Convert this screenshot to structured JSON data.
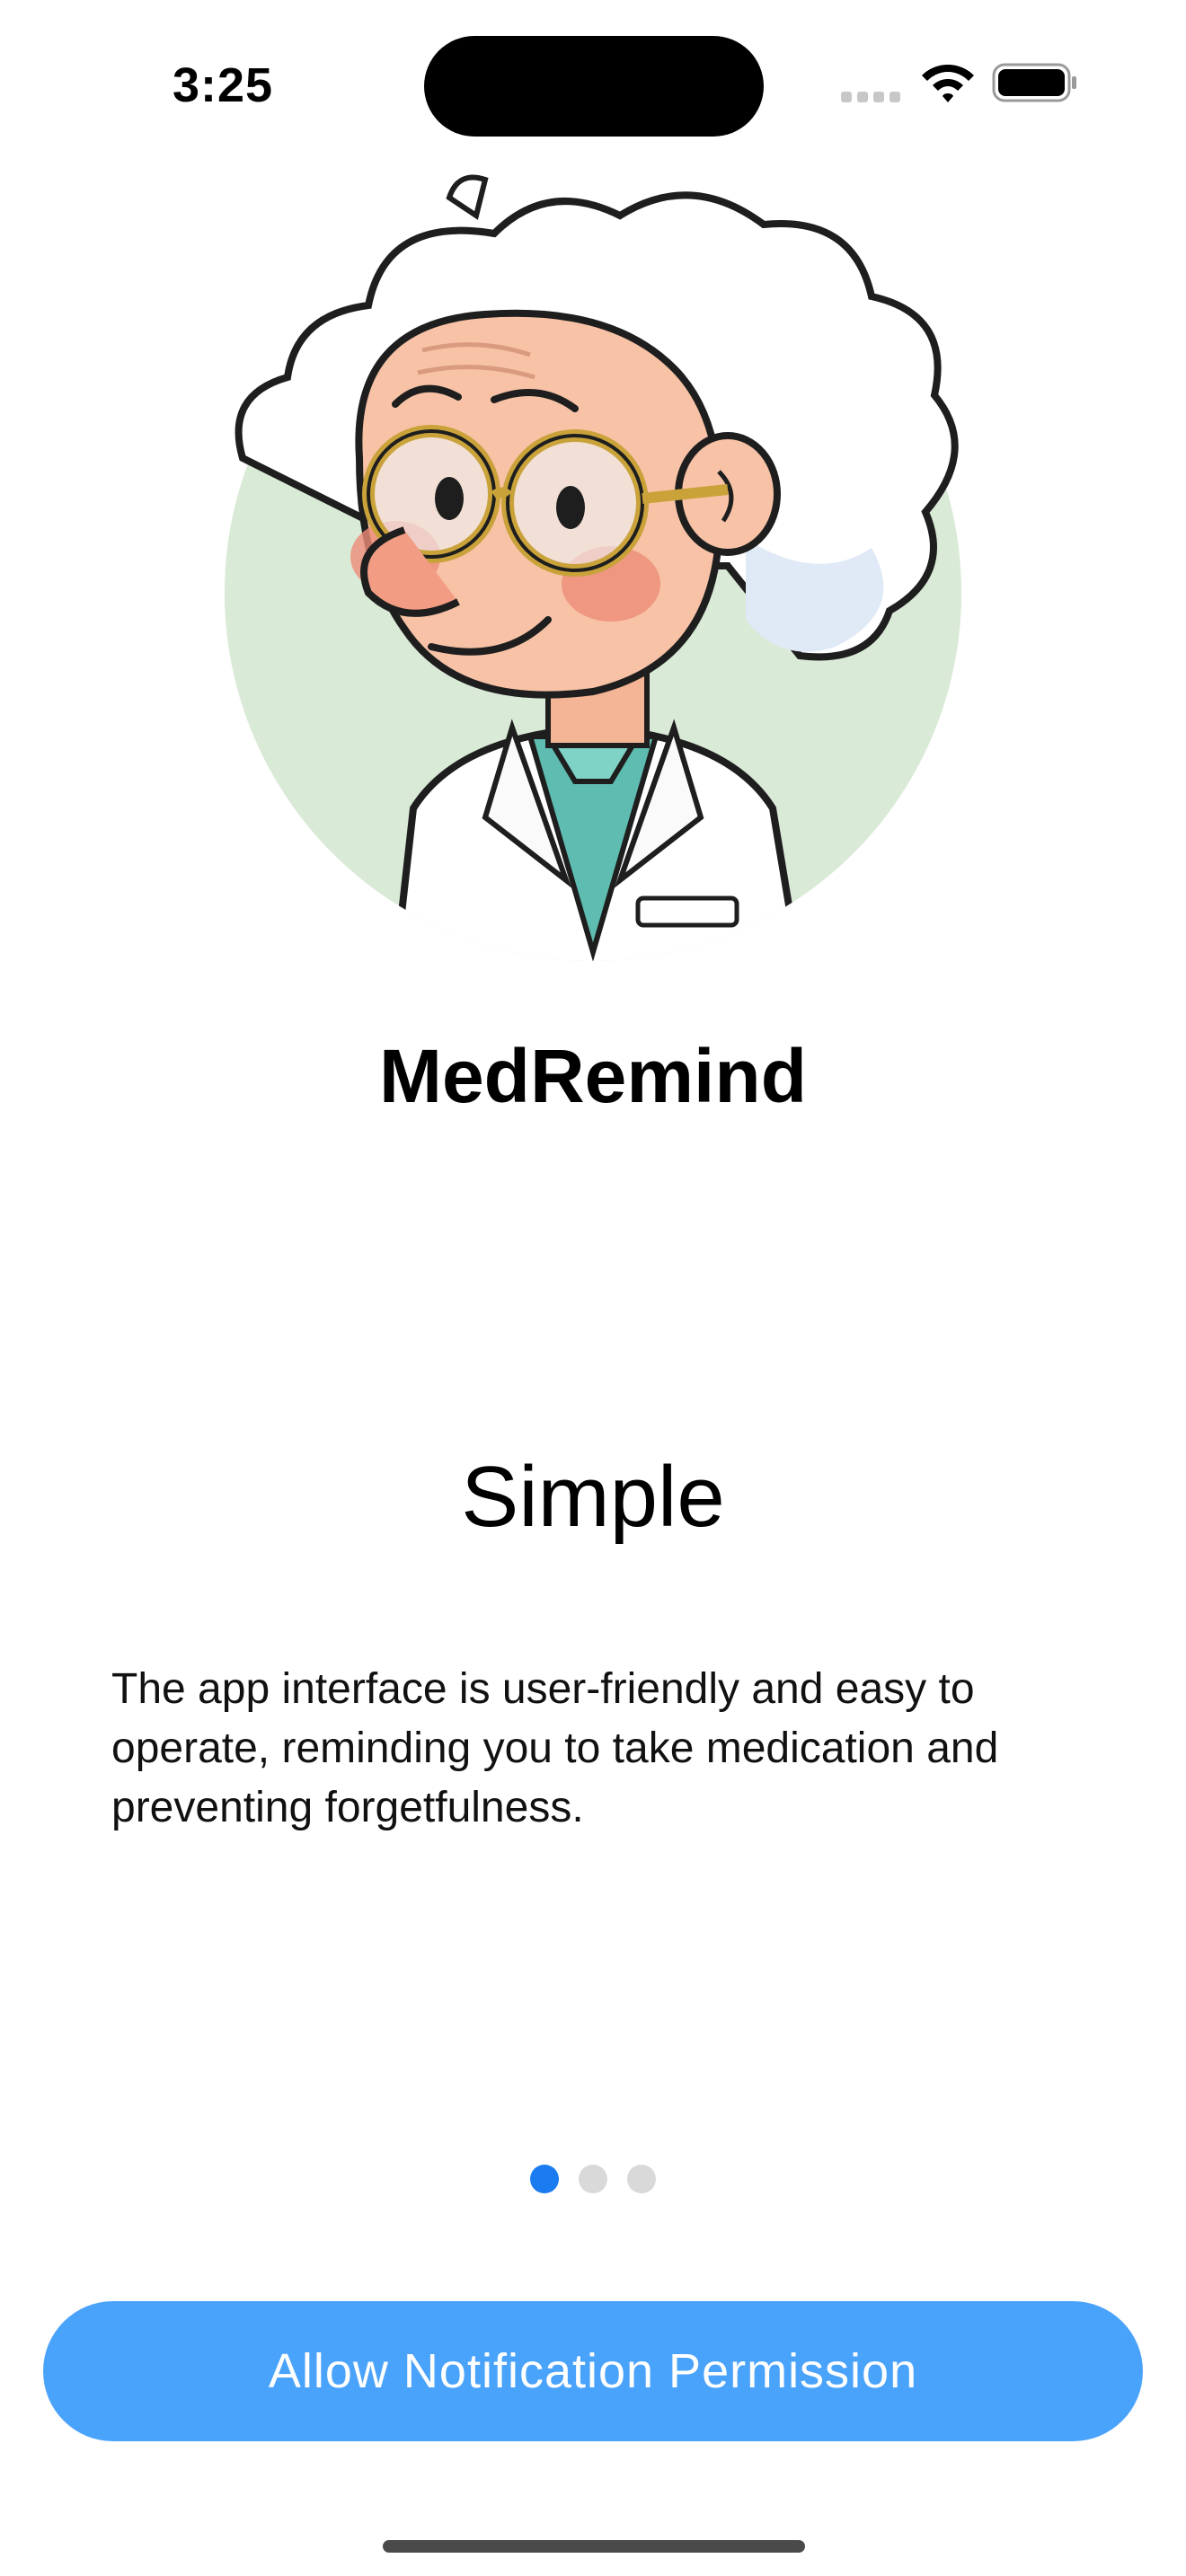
{
  "status_bar": {
    "time": "3:25",
    "icons": [
      "cellular-signal-icon",
      "wifi-icon",
      "battery-icon"
    ]
  },
  "avatar": {
    "icon": "doctor-avatar-illustration"
  },
  "app_title": "MedRemind",
  "page": {
    "heading": "Simple",
    "description": "The app interface is user-friendly and easy to operate, reminding you to take medication and preventing forgetfulness."
  },
  "pagination": {
    "total": 3,
    "current": 1
  },
  "primary_button": {
    "label": "Allow Notification Permission"
  },
  "colors": {
    "accent": "#1a7cf0",
    "button": "#4aa3fb",
    "dot_inactive": "#d9d9d9",
    "avatar_background": "#c9e2c6"
  }
}
